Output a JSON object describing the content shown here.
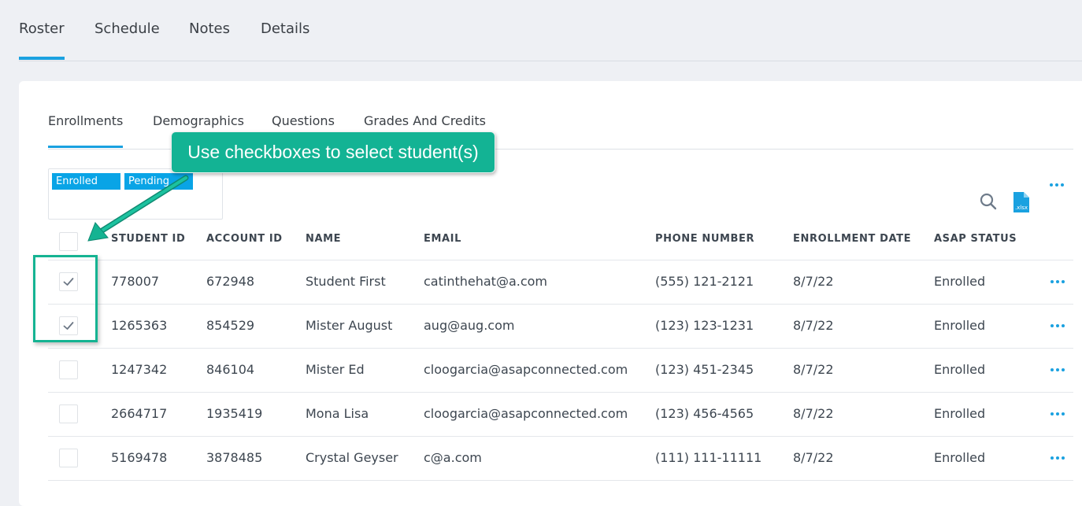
{
  "top_tabs": [
    "Roster",
    "Schedule",
    "Notes",
    "Details"
  ],
  "sub_tabs": [
    "Enrollments",
    "Demographics",
    "Questions",
    "Grades And Credits"
  ],
  "filters": [
    "Enrolled",
    "Pending"
  ],
  "toolbar": {
    "search_icon": "search-icon",
    "export_icon": "xlsx-file-icon",
    "export_label": ".xlsx",
    "more_icon": "more-horizontal-icon"
  },
  "table": {
    "headers": [
      "STUDENT ID",
      "ACCOUNT ID",
      "NAME",
      "EMAIL",
      "PHONE NUMBER",
      "ENROLLMENT DATE",
      "ASAP STATUS"
    ],
    "rows": [
      {
        "checked": true,
        "student_id": "778007",
        "account_id": "672948",
        "name": "Student First",
        "email": "catinthehat@a.com",
        "phone": "(555) 121-2121",
        "date": "8/7/22",
        "status": "Enrolled"
      },
      {
        "checked": true,
        "student_id": "1265363",
        "account_id": "854529",
        "name": "Mister August",
        "email": "aug@aug.com",
        "phone": "(123) 123-1231",
        "date": "8/7/22",
        "status": "Enrolled"
      },
      {
        "checked": false,
        "student_id": "1247342",
        "account_id": "846104",
        "name": "Mister Ed",
        "email": "cloogarcia@asapconnected.com",
        "phone": "(123) 451-2345",
        "date": "8/7/22",
        "status": "Enrolled"
      },
      {
        "checked": false,
        "student_id": "2664717",
        "account_id": "1935419",
        "name": "Mona Lisa",
        "email": "cloogarcia@asapconnected.com",
        "phone": "(123) 456-4565",
        "date": "8/7/22",
        "status": "Enrolled"
      },
      {
        "checked": false,
        "student_id": "5169478",
        "account_id": "3878485",
        "name": "Crystal Geyser",
        "email": "c@a.com",
        "phone": "(111) 111-11111",
        "date": "8/7/22",
        "status": "Enrolled"
      }
    ]
  },
  "annotation": {
    "callout_text": "Use checkboxes to select student(s)"
  },
  "colors": {
    "accent": "#1aa1e0",
    "chip": "#09a4e6",
    "callout": "#13b394"
  }
}
